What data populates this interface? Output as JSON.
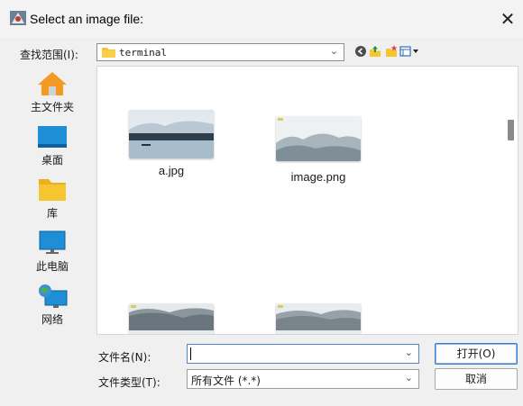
{
  "window": {
    "title": "Select an image file:",
    "close_glyph": "✕",
    "icon": "java-app-icon"
  },
  "look_in": {
    "label": "查找范围(I):",
    "current_folder": "terminal",
    "dropdown_icon": "chevron-down-icon"
  },
  "toolbar": {
    "buttons": [
      {
        "name": "back-button",
        "icon": "back-icon"
      },
      {
        "name": "up-one-level-button",
        "icon": "up-folder-icon"
      },
      {
        "name": "create-new-folder-button",
        "icon": "new-folder-icon"
      },
      {
        "name": "view-menu-button",
        "icon": "view-details-icon"
      }
    ]
  },
  "places": [
    {
      "label": "主文件夹",
      "icon": "home-icon"
    },
    {
      "label": "桌面",
      "icon": "desktop-icon"
    },
    {
      "label": "库",
      "icon": "folder-icon"
    },
    {
      "label": "此电脑",
      "icon": "computer-icon"
    },
    {
      "label": "网络",
      "icon": "network-icon"
    }
  ],
  "files": [
    {
      "name": "a.jpg",
      "icon": "image-thumbnail-icon"
    },
    {
      "name": "image.png",
      "icon": "image-thumbnail-icon"
    },
    {
      "name": "",
      "icon": "image-thumbnail-icon"
    },
    {
      "name": "",
      "icon": "image-thumbnail-icon"
    }
  ],
  "file_name": {
    "label": "文件名(N):",
    "value": ""
  },
  "file_type": {
    "label": "文件类型(T):",
    "selected": "所有文件 (*.*)"
  },
  "buttons": {
    "open": "打开(O)",
    "cancel": "取消"
  },
  "colors": {
    "home_orange": "#f39a22",
    "folder_yellow": "#f6c631",
    "desktop_blue": "#1e8fd6",
    "focus_blue": "#3b7ad1"
  }
}
